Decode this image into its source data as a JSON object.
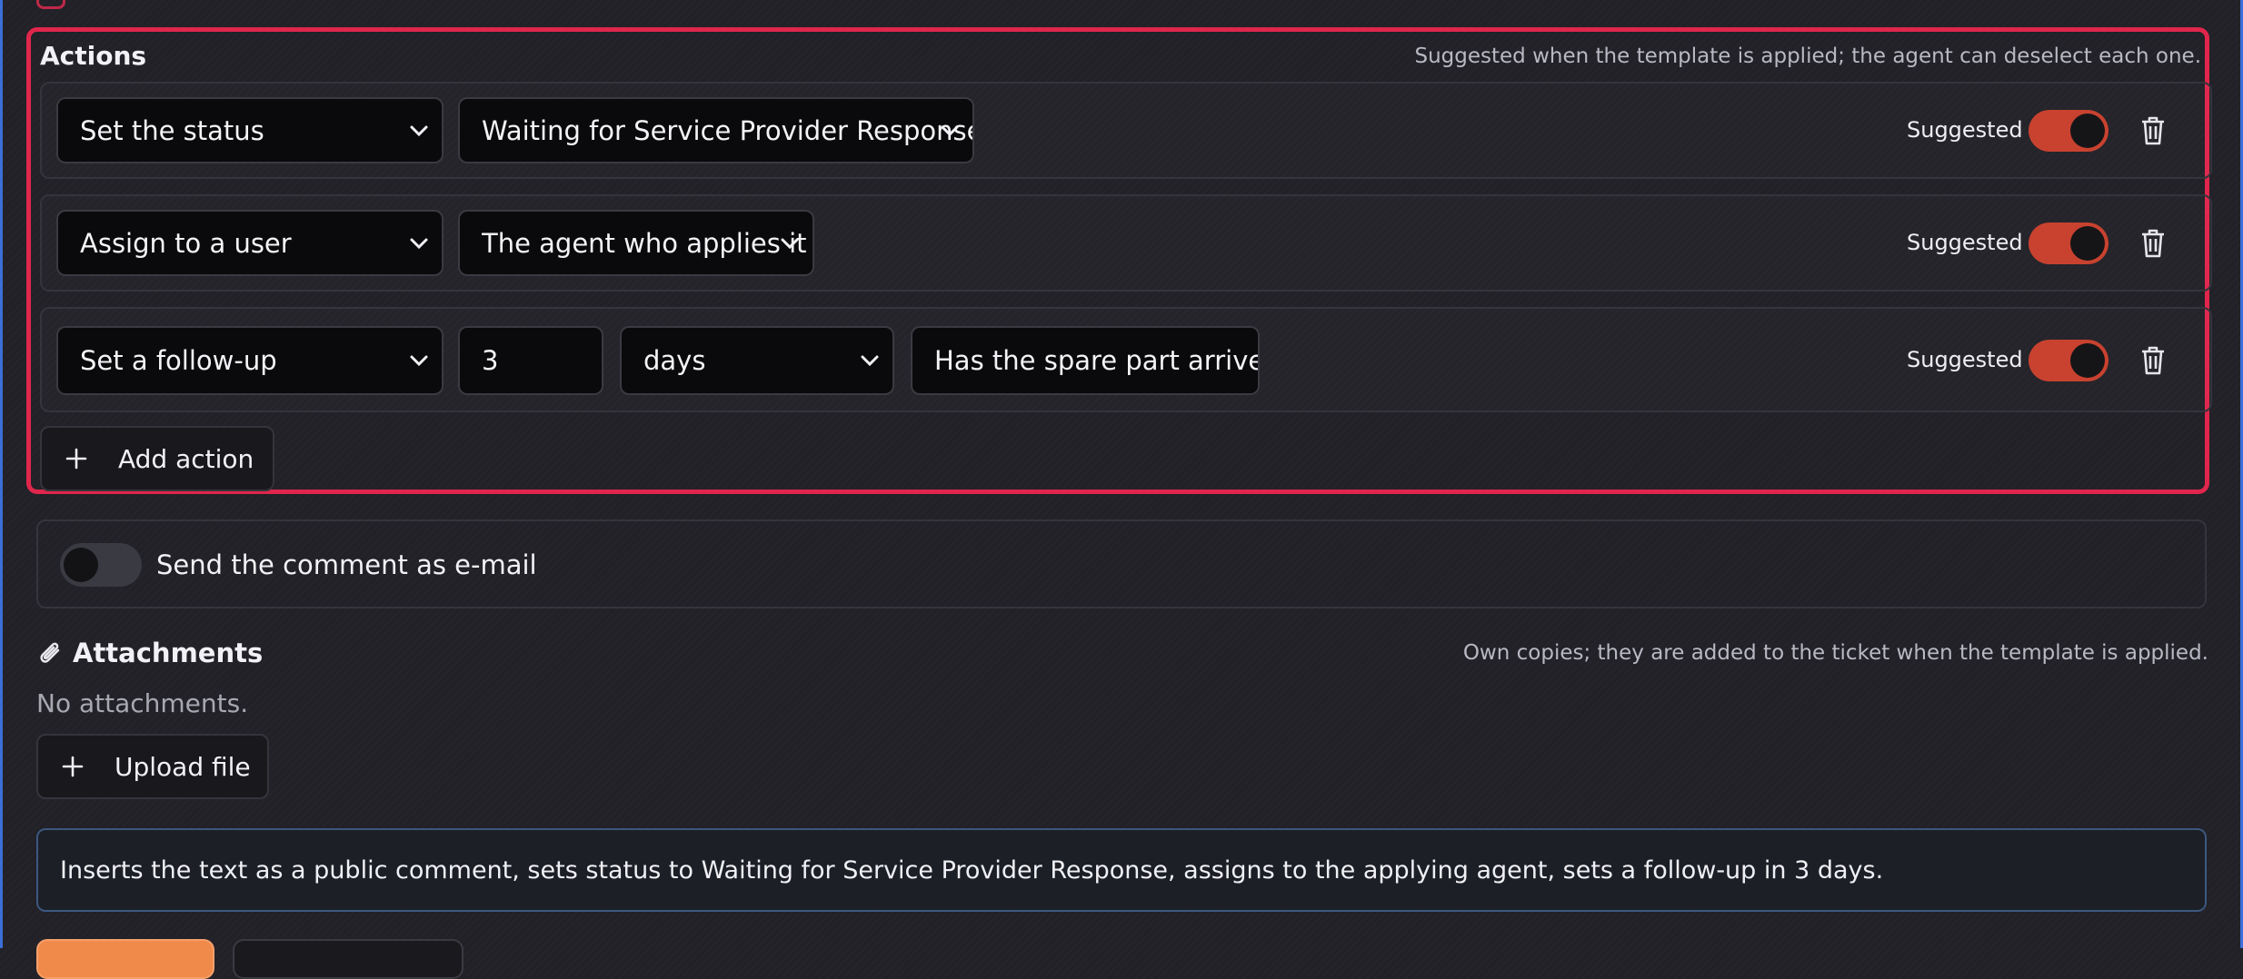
{
  "actions": {
    "title": "Actions",
    "hint": "Suggested when the template is applied; the agent can deselect each one.",
    "rows": [
      {
        "action": "Set the status",
        "value": "Waiting for Service Provider Response",
        "suggested_label": "Suggested",
        "suggested": true
      },
      {
        "action": "Assign to a user",
        "value": "The agent who applies it",
        "suggested_label": "Suggested",
        "suggested": true
      },
      {
        "action": "Set a follow-up",
        "amount": "3",
        "unit": "days",
        "note": "Has the spare part arrived",
        "suggested_label": "Suggested",
        "suggested": true
      }
    ],
    "add_label": "Add action"
  },
  "email": {
    "label": "Send the comment as e-mail",
    "enabled": false
  },
  "attachments": {
    "title": "Attachments",
    "hint": "Own copies; they are added to the ticket when the template is applied.",
    "empty_text": "No attachments.",
    "upload_label": "Upload file"
  },
  "summary": "Inserts the text as a public comment, sets status to Waiting for Service Provider Response, assigns to the applying agent, sets a follow-up in 3 days.",
  "colors": {
    "accent": "#e0264c",
    "toggle_on": "#c8422f",
    "primary_button": "#f08a4a"
  }
}
